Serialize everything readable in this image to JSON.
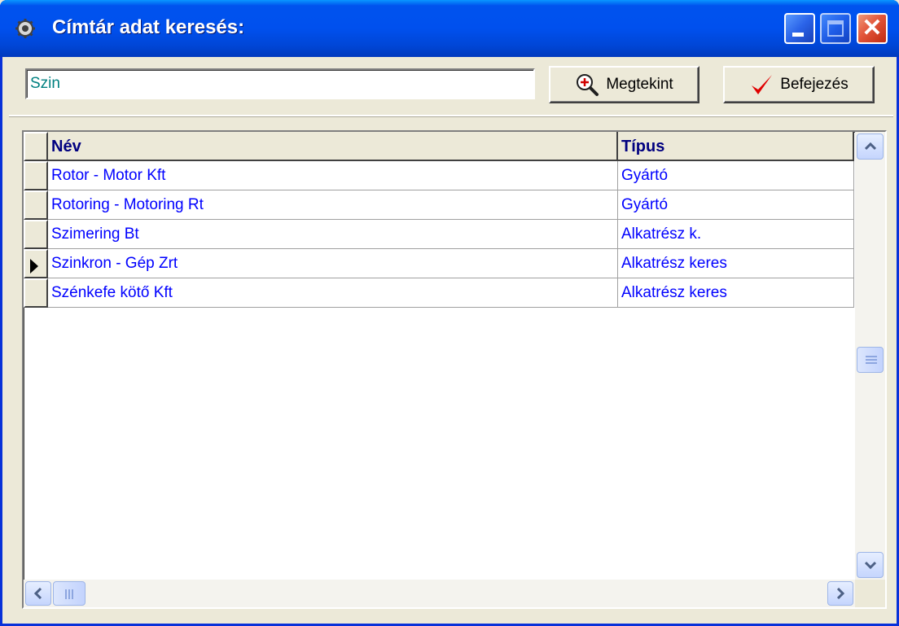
{
  "window": {
    "title": "Címtár adat keresés:",
    "icon": "gear-icon",
    "controls": [
      "minimize-icon",
      "maximize-icon",
      "close-icon"
    ],
    "colors": {
      "titlebar": "#0050ee",
      "close": "#e2553a",
      "face": "#ece9d8"
    }
  },
  "search": {
    "value": "Szin"
  },
  "buttons": {
    "view": {
      "label": "Megtekint",
      "icon": "magnifier-plus-icon"
    },
    "finish": {
      "label": "Befejezés",
      "icon": "checkmark-icon",
      "icon_color": "#e00000"
    }
  },
  "grid": {
    "columns": [
      "Név",
      "Típus"
    ],
    "rows": [
      {
        "name": "Rotor - Motor Kft",
        "type": "Gyártó",
        "current": false
      },
      {
        "name": "Rotoring - Motoring Rt",
        "type": "Gyártó",
        "current": false
      },
      {
        "name": "Szimering Bt",
        "type": "Alkatrész k.",
        "current": false
      },
      {
        "name": "Szinkron - Gép Zrt",
        "type": "Alkatrész keres",
        "current": true
      },
      {
        "name": "Szénkefe kötő Kft",
        "type": "Alkatrész keres",
        "current": false
      }
    ],
    "text_color": "#0000ff",
    "header_color": "#000080"
  }
}
